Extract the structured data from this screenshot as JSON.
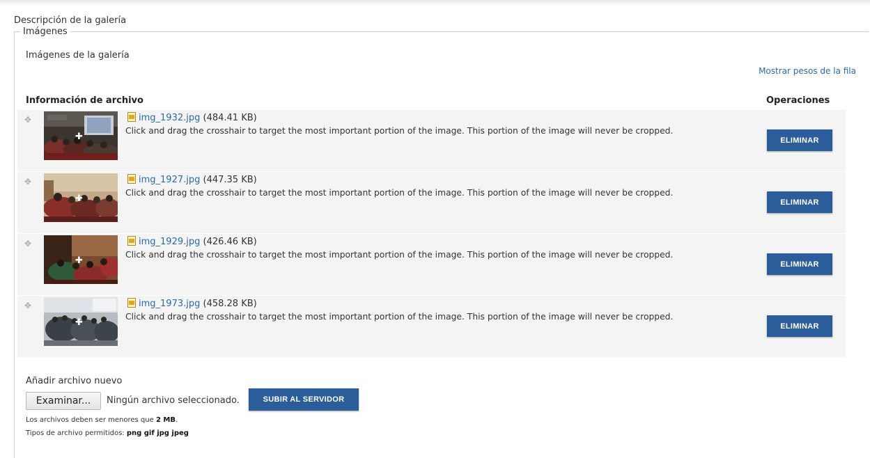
{
  "gallery_description_label": "Descripción de la galería",
  "images_legend": "Imágenes",
  "gallery_images_label": "Imágenes de la galería",
  "show_weights_link": "Mostrar pesos de la fila",
  "table": {
    "col_info": "Información de archivo",
    "col_ops": "Operaciones",
    "rows": [
      {
        "filename": "img_1932.jpg",
        "size": "(484.41 KB)",
        "hint": "Click and drag the crosshair to target the most important portion of the image. This portion of the image will never be cropped.",
        "remove_label": "ELIMINAR"
      },
      {
        "filename": "img_1927.jpg",
        "size": "(447.35 KB)",
        "hint": "Click and drag the crosshair to target the most important portion of the image. This portion of the image will never be cropped.",
        "remove_label": "ELIMINAR"
      },
      {
        "filename": "img_1929.jpg",
        "size": "(426.46 KB)",
        "hint": "Click and drag the crosshair to target the most important portion of the image. This portion of the image will never be cropped.",
        "remove_label": "ELIMINAR"
      },
      {
        "filename": "img_1973.jpg",
        "size": "(458.28 KB)",
        "hint": "Click and drag the crosshair to target the most important portion of the image. This portion of the image will never be cropped.",
        "remove_label": "ELIMINAR"
      }
    ]
  },
  "upload": {
    "add_label": "Añadir archivo nuevo",
    "browse_label": "Examinar...",
    "no_file_text": "Ningún archivo seleccionado.",
    "upload_button": "SUBIR AL SERVIDOR",
    "size_note_prefix": "Los archivos deben ser menores que",
    "size_note_value": "2 MB",
    "size_note_suffix": ".",
    "types_note_prefix": "Tipos de archivo permitidos:",
    "types_note_value": "png gif jpg jpeg"
  },
  "colors": {
    "button_bg": "#2a5d9a",
    "link": "#2a6aa8",
    "row_bg": "#f4f4f4"
  }
}
